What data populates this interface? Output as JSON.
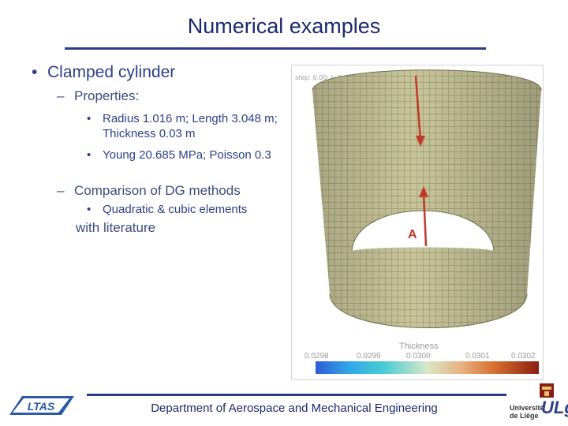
{
  "slide": {
    "title": "Numerical examples",
    "footer": "Department of Aerospace and Mechanical Engineering"
  },
  "bullets": {
    "l1": {
      "marker": "•",
      "text": "Clamped cylinder"
    },
    "l2a": {
      "marker": "–",
      "text": "Properties:"
    },
    "l3a": {
      "marker": "•",
      "text": "Radius 1.016 m; Length 3.048 m; Thickness 0.03 m"
    },
    "l3b": {
      "marker": "•",
      "text": "Young 20.685 MPa; Poisson 0.3"
    },
    "l2b": {
      "marker": "–",
      "text": "Comparison of DG methods"
    },
    "l3c": {
      "marker": "•",
      "text": "Quadratic & cubic elements"
    },
    "l2c": {
      "text": "with literature"
    }
  },
  "figure": {
    "header": "step: 0.00; t: 0.0000",
    "point_label": "A",
    "legend_title": "Thickness",
    "legend_ticks": [
      "0.0298",
      "0.0299",
      "0.0300",
      "0.0301",
      "0.0302"
    ],
    "mesh_color": "#9a9a6a",
    "surface_color": "#c8c49a",
    "arrow_color": "#c0392b"
  },
  "logos": {
    "left": "LTAS",
    "right_name": "Université de Liège",
    "right_letters": "ULg"
  }
}
